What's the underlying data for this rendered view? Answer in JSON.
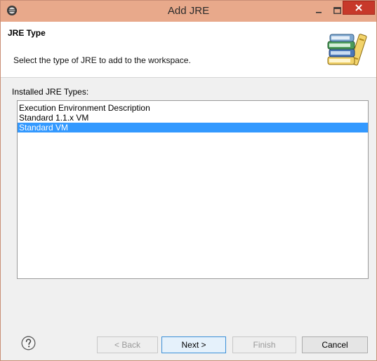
{
  "window": {
    "title": "Add JRE",
    "icon": "eclipse-icon"
  },
  "header": {
    "title": "JRE Type",
    "description": "Select the type of JRE to add to the workspace.",
    "image": "books-icon"
  },
  "jre_types": {
    "label": "Installed JRE Types:",
    "items": [
      {
        "label": "Execution Environment Description",
        "selected": false
      },
      {
        "label": "Standard 1.1.x VM",
        "selected": false
      },
      {
        "label": "Standard VM",
        "selected": true
      }
    ]
  },
  "buttons": {
    "help_icon": "help-icon",
    "back": "< Back",
    "next": "Next >",
    "finish": "Finish",
    "cancel": "Cancel"
  },
  "colors": {
    "titlebar": "#e8a98b",
    "close_button": "#c7392a",
    "selection": "#3399ff",
    "default_button_border": "#3a8fd8"
  }
}
